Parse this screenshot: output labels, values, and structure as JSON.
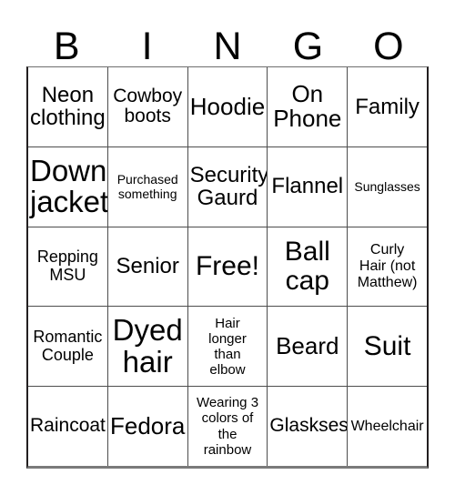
{
  "card": {
    "title_letters": [
      "B",
      "I",
      "N",
      "G",
      "O"
    ],
    "columns": 5,
    "rows": 5,
    "free_space": "Free!",
    "grid": [
      [
        {
          "text": "Neon\nclothing",
          "size": "fs-xl"
        },
        {
          "text": "Cowboy\nboots",
          "size": "fs-lg"
        },
        {
          "text": "Hoodie",
          "size": "fs-2xl"
        },
        {
          "text": "On\nPhone",
          "size": "fs-2xl"
        },
        {
          "text": "Family",
          "size": "fs-xl"
        }
      ],
      [
        {
          "text": "Down\njacket",
          "size": "fs-4xl"
        },
        {
          "text": "Purchased\nsomething",
          "size": "fs-xs"
        },
        {
          "text": "Security\nGaurd",
          "size": "fs-xl"
        },
        {
          "text": "Flannel",
          "size": "fs-xl"
        },
        {
          "text": "Sunglasses",
          "size": "fs-xs"
        }
      ],
      [
        {
          "text": "Repping\nMSU",
          "size": "fs-md"
        },
        {
          "text": "Senior",
          "size": "fs-xl"
        },
        {
          "text": "Free!",
          "size": "fs-3xl"
        },
        {
          "text": "Ball\ncap",
          "size": "fs-3xl"
        },
        {
          "text": "Curly\nHair (not\nMatthew)",
          "size": "fs-smp"
        }
      ],
      [
        {
          "text": "Romantic\nCouple",
          "size": "fs-md"
        },
        {
          "text": "Dyed\nhair",
          "size": "fs-4xl"
        },
        {
          "text": "Hair\nlonger\nthan\nelbow",
          "size": "fs-sm"
        },
        {
          "text": "Beard",
          "size": "fs-2xl"
        },
        {
          "text": "Suit",
          "size": "fs-3xl"
        }
      ],
      [
        {
          "text": "Raincoat",
          "size": "fs-lg"
        },
        {
          "text": "Fedora",
          "size": "fs-2xl"
        },
        {
          "text": "Wearing 3\ncolors of\nthe\nrainbow",
          "size": "fs-sm"
        },
        {
          "text": "Glaskses",
          "size": "fs-lg"
        },
        {
          "text": "Wheelchair",
          "size": "fs-smp"
        }
      ]
    ]
  },
  "colors": {
    "background": "#ffffff",
    "text": "#000000",
    "grid_line": "#4d4d4d",
    "outer_border": "#231f20"
  }
}
